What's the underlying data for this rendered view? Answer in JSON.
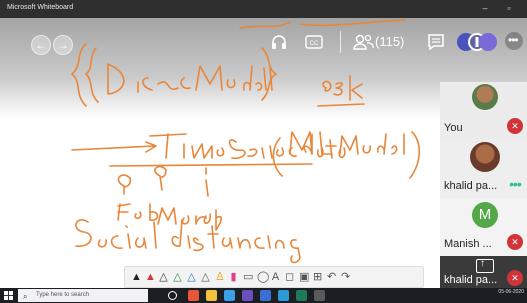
{
  "window": {
    "title": "Microsoft Whiteboard",
    "minimize": "–",
    "maximize": "▫"
  },
  "board": {
    "ink_text": [
      "Disease Modelling",
      "83k",
      "Time Series data",
      "(ML Model)",
      "Feb",
      "Mar",
      "Ap",
      "Social distancing"
    ],
    "ink_color": "#e8863a"
  },
  "meeting": {
    "participant_count": "(115)",
    "participants": [
      {
        "name": "You",
        "status": "muted",
        "avatar": "photo"
      },
      {
        "name": "khalid pa...",
        "status": "more",
        "avatar": "photo"
      },
      {
        "name": "Manish ...",
        "status": "muted",
        "avatar": "M",
        "avatar_color": "#54a84a"
      },
      {
        "name": "khalid pa...",
        "status": "muted",
        "avatar": "share-screen-icon"
      }
    ]
  },
  "taskbar": {
    "search_placeholder": "Type here to search",
    "time": "",
    "date": "05-06-2020"
  }
}
